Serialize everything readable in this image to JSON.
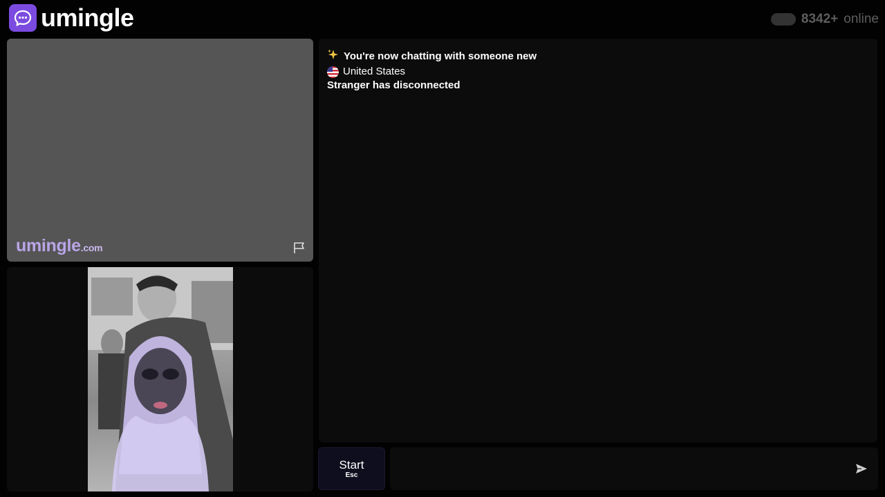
{
  "header": {
    "logo_text": "umingle",
    "online_count": "8342+",
    "online_label": "online"
  },
  "stranger_video": {
    "watermark_brand": "umingle",
    "watermark_tld": ".com"
  },
  "chat": {
    "messages": [
      {
        "icon": "sparkles",
        "text": "You're now chatting with someone new"
      },
      {
        "icon": "us-flag",
        "text": "United States"
      },
      {
        "icon": null,
        "text": "Stranger has disconnected"
      }
    ]
  },
  "controls": {
    "start_label": "Start",
    "start_hint": "Esc",
    "message_placeholder": ""
  },
  "colors": {
    "brand": "#7b4be0",
    "background": "#020202",
    "panel": "#0c0c0c"
  }
}
